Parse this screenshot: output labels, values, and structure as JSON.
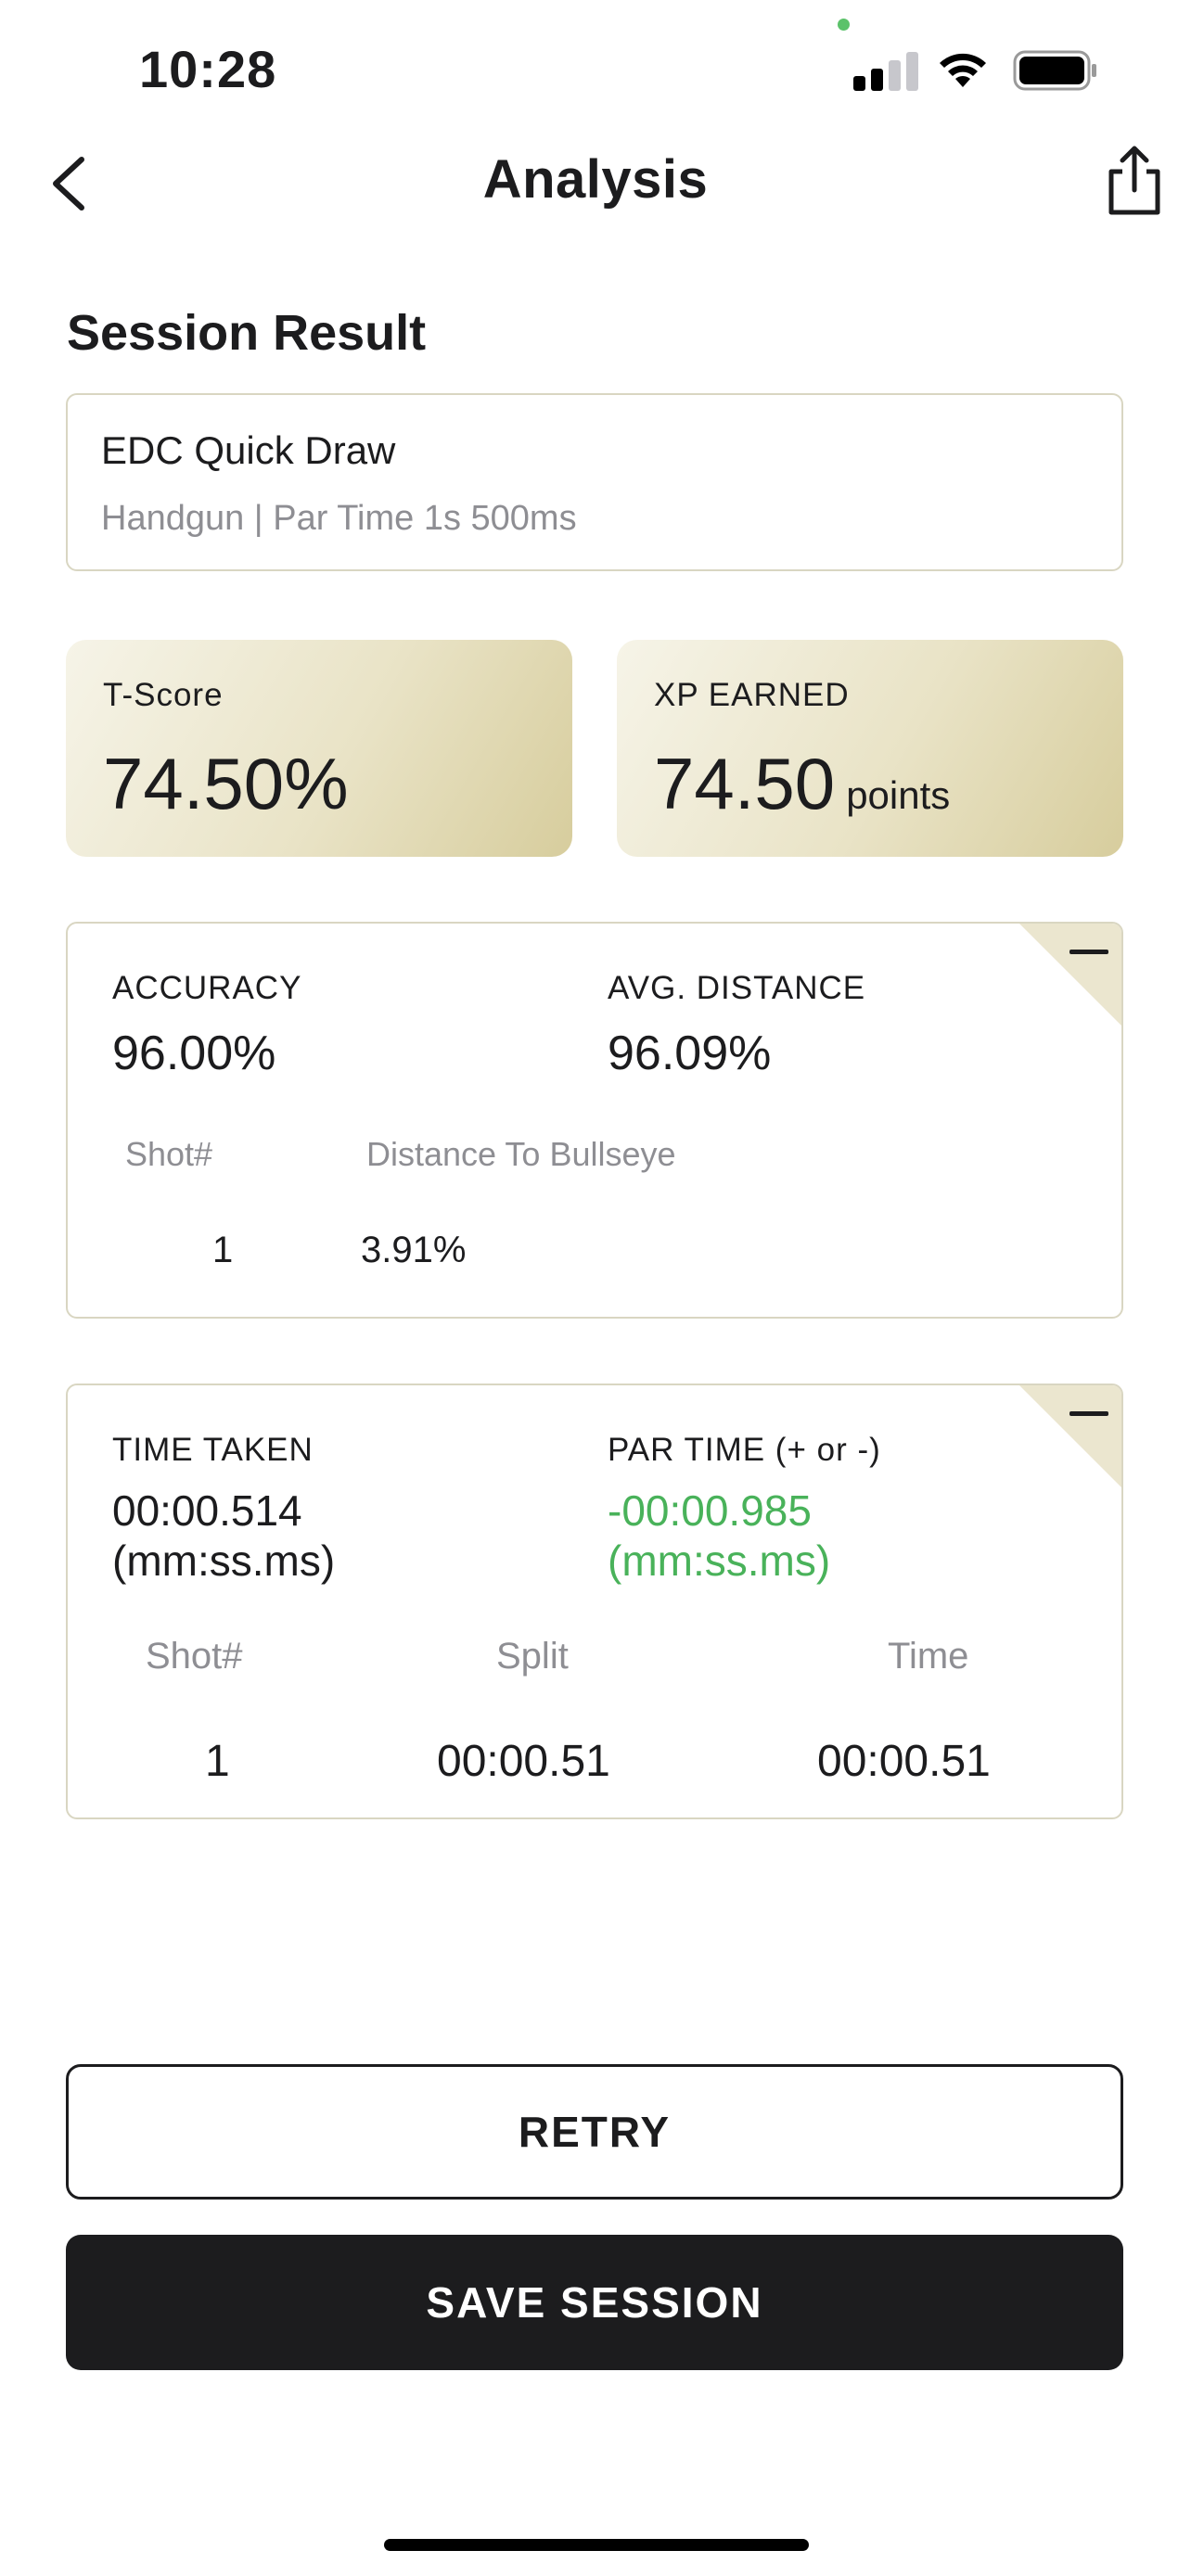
{
  "status_bar": {
    "time": "10:28"
  },
  "nav": {
    "title": "Analysis"
  },
  "section_title": "Session Result",
  "session": {
    "name": "EDC Quick Draw",
    "subtitle": "Handgun | Par Time 1s 500ms"
  },
  "score_cards": [
    {
      "label": "T-Score",
      "value": "74.50%",
      "unit": ""
    },
    {
      "label": "XP EARNED",
      "value": "74.50",
      "unit": "points"
    }
  ],
  "accuracy_card": {
    "accuracy_label": "ACCURACY",
    "accuracy_value": "96.00%",
    "avg_distance_label": "AVG. DISTANCE",
    "avg_distance_value": "96.09%",
    "columns": [
      "Shot#",
      "Distance To Bullseye"
    ],
    "rows": [
      {
        "shot": "1",
        "distance": "3.91%"
      }
    ]
  },
  "time_card": {
    "time_taken_label": "TIME TAKEN",
    "time_taken_value": "00:00.514",
    "time_taken_unit": "(mm:ss.ms)",
    "par_time_label": "PAR TIME (+ or -)",
    "par_time_value": "-00:00.985",
    "par_time_unit": "(mm:ss.ms)",
    "par_time_color": "#49b25a",
    "columns": [
      "Shot#",
      "Split",
      "Time"
    ],
    "rows": [
      {
        "shot": "1",
        "split": "00:00.51",
        "time": "00:00.51"
      }
    ]
  },
  "buttons": {
    "retry": "RETRY",
    "save": "SAVE SESSION"
  },
  "icons": [
    "back-chevron-icon",
    "share-icon",
    "cellular-signal-icon",
    "wifi-icon",
    "battery-icon",
    "collapse-minus-icon"
  ]
}
